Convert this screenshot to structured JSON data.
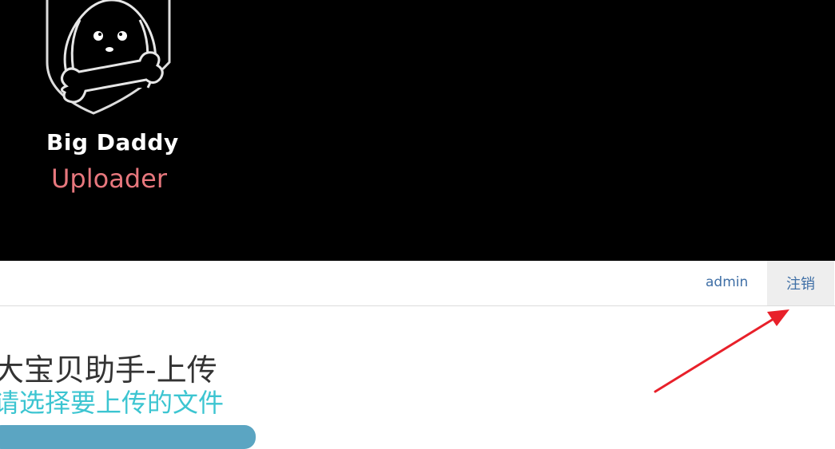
{
  "brand": {
    "line1": "Big Daddy",
    "line2": "Uploader",
    "logo_icon": "dog-shield-bone-icon"
  },
  "nav": {
    "user": "admin",
    "logout": "注销"
  },
  "page": {
    "title": "大宝贝助手-上传",
    "subtitle": "请选择要上传的文件"
  },
  "annotation": {
    "arrow_icon": "red-arrow-icon",
    "color": "#e8202a"
  },
  "colors": {
    "header_bg": "#000000",
    "brand_accent": "#e7777d",
    "link": "#3f6fa6",
    "subtitle": "#3cc5d1"
  }
}
